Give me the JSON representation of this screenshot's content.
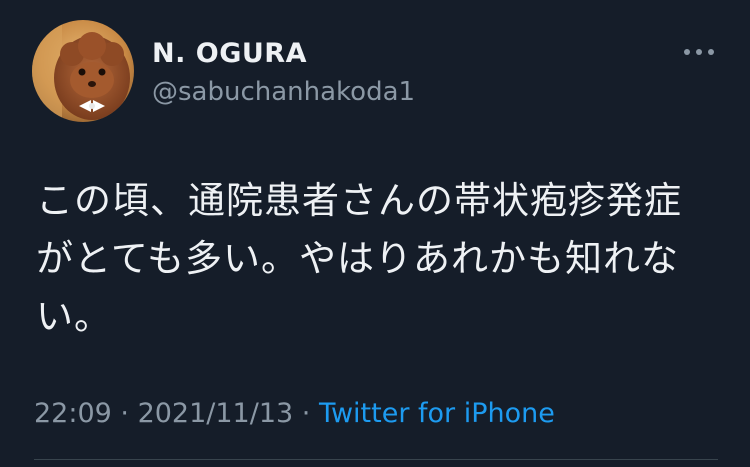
{
  "user": {
    "display_name": "N. OGURA",
    "handle": "@sabuchanhakoda1"
  },
  "tweet": {
    "text": "この頃、通院患者さんの帯状疱疹発症がとても多い。やはりあれかも知れない。",
    "time": "22:09",
    "separator": " · ",
    "date": "2021/11/13",
    "source": "Twitter for iPhone"
  },
  "icons": {
    "more": "more-horizontal-icon",
    "avatar": "dog-avatar"
  },
  "colors": {
    "background": "#151d29",
    "text": "#eef1f4",
    "secondary": "#8b98a5",
    "link": "#1d9bf0"
  }
}
